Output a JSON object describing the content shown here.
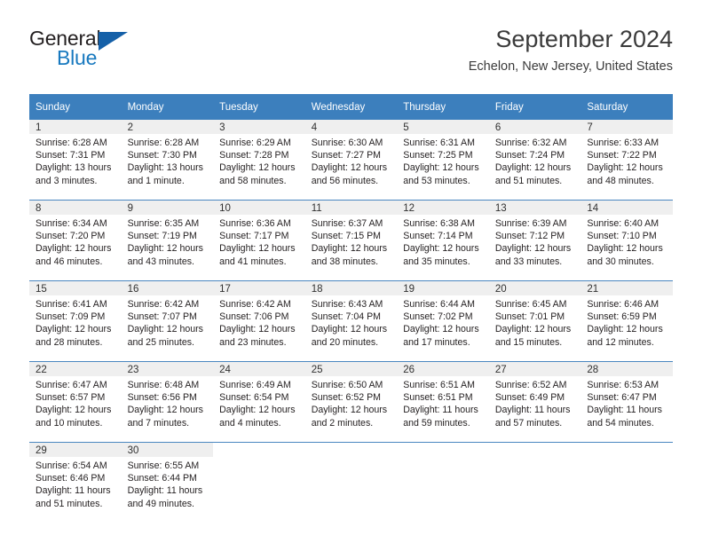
{
  "brand": {
    "word_one": "General",
    "word_two": "Blue",
    "mark": "triangle-logo-mark"
  },
  "header": {
    "title": "September 2024",
    "subtitle": "Echelon, New Jersey, United States"
  },
  "weekday_headers": [
    "Sunday",
    "Monday",
    "Tuesday",
    "Wednesday",
    "Thursday",
    "Friday",
    "Saturday"
  ],
  "colors": {
    "header_blue": "#3c7fbd",
    "row_divider_blue": "#4a87c0",
    "daynum_strip_gray": "#efefef",
    "brand_blue": "#1879bf",
    "brand_mark_blue": "#1560a8",
    "text": "#231f20"
  },
  "weeks": [
    [
      {
        "day": "1",
        "sunrise": "Sunrise: 6:28 AM",
        "sunset": "Sunset: 7:31 PM",
        "daylight_1": "Daylight: 13 hours",
        "daylight_2": "and 3 minutes."
      },
      {
        "day": "2",
        "sunrise": "Sunrise: 6:28 AM",
        "sunset": "Sunset: 7:30 PM",
        "daylight_1": "Daylight: 13 hours",
        "daylight_2": "and 1 minute."
      },
      {
        "day": "3",
        "sunrise": "Sunrise: 6:29 AM",
        "sunset": "Sunset: 7:28 PM",
        "daylight_1": "Daylight: 12 hours",
        "daylight_2": "and 58 minutes."
      },
      {
        "day": "4",
        "sunrise": "Sunrise: 6:30 AM",
        "sunset": "Sunset: 7:27 PM",
        "daylight_1": "Daylight: 12 hours",
        "daylight_2": "and 56 minutes."
      },
      {
        "day": "5",
        "sunrise": "Sunrise: 6:31 AM",
        "sunset": "Sunset: 7:25 PM",
        "daylight_1": "Daylight: 12 hours",
        "daylight_2": "and 53 minutes."
      },
      {
        "day": "6",
        "sunrise": "Sunrise: 6:32 AM",
        "sunset": "Sunset: 7:24 PM",
        "daylight_1": "Daylight: 12 hours",
        "daylight_2": "and 51 minutes."
      },
      {
        "day": "7",
        "sunrise": "Sunrise: 6:33 AM",
        "sunset": "Sunset: 7:22 PM",
        "daylight_1": "Daylight: 12 hours",
        "daylight_2": "and 48 minutes."
      }
    ],
    [
      {
        "day": "8",
        "sunrise": "Sunrise: 6:34 AM",
        "sunset": "Sunset: 7:20 PM",
        "daylight_1": "Daylight: 12 hours",
        "daylight_2": "and 46 minutes."
      },
      {
        "day": "9",
        "sunrise": "Sunrise: 6:35 AM",
        "sunset": "Sunset: 7:19 PM",
        "daylight_1": "Daylight: 12 hours",
        "daylight_2": "and 43 minutes."
      },
      {
        "day": "10",
        "sunrise": "Sunrise: 6:36 AM",
        "sunset": "Sunset: 7:17 PM",
        "daylight_1": "Daylight: 12 hours",
        "daylight_2": "and 41 minutes."
      },
      {
        "day": "11",
        "sunrise": "Sunrise: 6:37 AM",
        "sunset": "Sunset: 7:15 PM",
        "daylight_1": "Daylight: 12 hours",
        "daylight_2": "and 38 minutes."
      },
      {
        "day": "12",
        "sunrise": "Sunrise: 6:38 AM",
        "sunset": "Sunset: 7:14 PM",
        "daylight_1": "Daylight: 12 hours",
        "daylight_2": "and 35 minutes."
      },
      {
        "day": "13",
        "sunrise": "Sunrise: 6:39 AM",
        "sunset": "Sunset: 7:12 PM",
        "daylight_1": "Daylight: 12 hours",
        "daylight_2": "and 33 minutes."
      },
      {
        "day": "14",
        "sunrise": "Sunrise: 6:40 AM",
        "sunset": "Sunset: 7:10 PM",
        "daylight_1": "Daylight: 12 hours",
        "daylight_2": "and 30 minutes."
      }
    ],
    [
      {
        "day": "15",
        "sunrise": "Sunrise: 6:41 AM",
        "sunset": "Sunset: 7:09 PM",
        "daylight_1": "Daylight: 12 hours",
        "daylight_2": "and 28 minutes."
      },
      {
        "day": "16",
        "sunrise": "Sunrise: 6:42 AM",
        "sunset": "Sunset: 7:07 PM",
        "daylight_1": "Daylight: 12 hours",
        "daylight_2": "and 25 minutes."
      },
      {
        "day": "17",
        "sunrise": "Sunrise: 6:42 AM",
        "sunset": "Sunset: 7:06 PM",
        "daylight_1": "Daylight: 12 hours",
        "daylight_2": "and 23 minutes."
      },
      {
        "day": "18",
        "sunrise": "Sunrise: 6:43 AM",
        "sunset": "Sunset: 7:04 PM",
        "daylight_1": "Daylight: 12 hours",
        "daylight_2": "and 20 minutes."
      },
      {
        "day": "19",
        "sunrise": "Sunrise: 6:44 AM",
        "sunset": "Sunset: 7:02 PM",
        "daylight_1": "Daylight: 12 hours",
        "daylight_2": "and 17 minutes."
      },
      {
        "day": "20",
        "sunrise": "Sunrise: 6:45 AM",
        "sunset": "Sunset: 7:01 PM",
        "daylight_1": "Daylight: 12 hours",
        "daylight_2": "and 15 minutes."
      },
      {
        "day": "21",
        "sunrise": "Sunrise: 6:46 AM",
        "sunset": "Sunset: 6:59 PM",
        "daylight_1": "Daylight: 12 hours",
        "daylight_2": "and 12 minutes."
      }
    ],
    [
      {
        "day": "22",
        "sunrise": "Sunrise: 6:47 AM",
        "sunset": "Sunset: 6:57 PM",
        "daylight_1": "Daylight: 12 hours",
        "daylight_2": "and 10 minutes."
      },
      {
        "day": "23",
        "sunrise": "Sunrise: 6:48 AM",
        "sunset": "Sunset: 6:56 PM",
        "daylight_1": "Daylight: 12 hours",
        "daylight_2": "and 7 minutes."
      },
      {
        "day": "24",
        "sunrise": "Sunrise: 6:49 AM",
        "sunset": "Sunset: 6:54 PM",
        "daylight_1": "Daylight: 12 hours",
        "daylight_2": "and 4 minutes."
      },
      {
        "day": "25",
        "sunrise": "Sunrise: 6:50 AM",
        "sunset": "Sunset: 6:52 PM",
        "daylight_1": "Daylight: 12 hours",
        "daylight_2": "and 2 minutes."
      },
      {
        "day": "26",
        "sunrise": "Sunrise: 6:51 AM",
        "sunset": "Sunset: 6:51 PM",
        "daylight_1": "Daylight: 11 hours",
        "daylight_2": "and 59 minutes."
      },
      {
        "day": "27",
        "sunrise": "Sunrise: 6:52 AM",
        "sunset": "Sunset: 6:49 PM",
        "daylight_1": "Daylight: 11 hours",
        "daylight_2": "and 57 minutes."
      },
      {
        "day": "28",
        "sunrise": "Sunrise: 6:53 AM",
        "sunset": "Sunset: 6:47 PM",
        "daylight_1": "Daylight: 11 hours",
        "daylight_2": "and 54 minutes."
      }
    ],
    [
      {
        "day": "29",
        "sunrise": "Sunrise: 6:54 AM",
        "sunset": "Sunset: 6:46 PM",
        "daylight_1": "Daylight: 11 hours",
        "daylight_2": "and 51 minutes."
      },
      {
        "day": "30",
        "sunrise": "Sunrise: 6:55 AM",
        "sunset": "Sunset: 6:44 PM",
        "daylight_1": "Daylight: 11 hours",
        "daylight_2": "and 49 minutes."
      },
      {
        "day": "",
        "sunrise": "",
        "sunset": "",
        "daylight_1": "",
        "daylight_2": ""
      },
      {
        "day": "",
        "sunrise": "",
        "sunset": "",
        "daylight_1": "",
        "daylight_2": ""
      },
      {
        "day": "",
        "sunrise": "",
        "sunset": "",
        "daylight_1": "",
        "daylight_2": ""
      },
      {
        "day": "",
        "sunrise": "",
        "sunset": "",
        "daylight_1": "",
        "daylight_2": ""
      },
      {
        "day": "",
        "sunrise": "",
        "sunset": "",
        "daylight_1": "",
        "daylight_2": ""
      }
    ]
  ]
}
